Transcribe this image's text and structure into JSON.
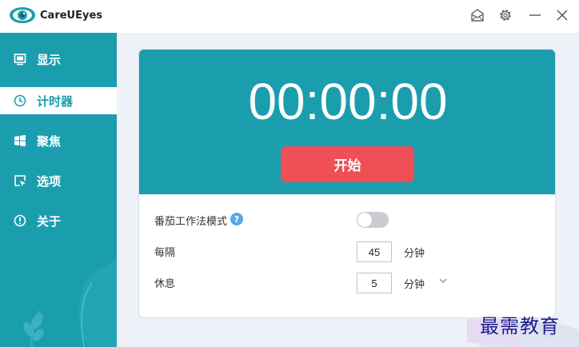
{
  "app": {
    "title": "CareUEyes"
  },
  "window_controls": {
    "icons": [
      "mail-icon",
      "gear-icon",
      "minimize-icon",
      "close-icon"
    ]
  },
  "sidebar": {
    "items": [
      {
        "label": "显示",
        "icon": "monitor-icon",
        "active": false
      },
      {
        "label": "计时器",
        "icon": "clock-icon",
        "active": true
      },
      {
        "label": "聚焦",
        "icon": "windows-icon",
        "active": false
      },
      {
        "label": "选项",
        "icon": "cursor-window-icon",
        "active": false
      },
      {
        "label": "关于",
        "icon": "info-icon",
        "active": false
      }
    ]
  },
  "timer": {
    "display": "00:00:00",
    "start_label": "开始"
  },
  "settings": {
    "pomodoro_label": "番茄工作法模式",
    "pomodoro_help": "?",
    "pomodoro_enabled": false,
    "interval_label": "每隔",
    "interval_value": "45",
    "interval_unit": "分钟",
    "rest_label": "休息",
    "rest_value": "5",
    "rest_unit": "分钟"
  },
  "watermark": {
    "text": "最需教育"
  },
  "colors": {
    "accent": "#1a9eae",
    "start_button": "#ef4f57",
    "background": "#eef1f7"
  }
}
